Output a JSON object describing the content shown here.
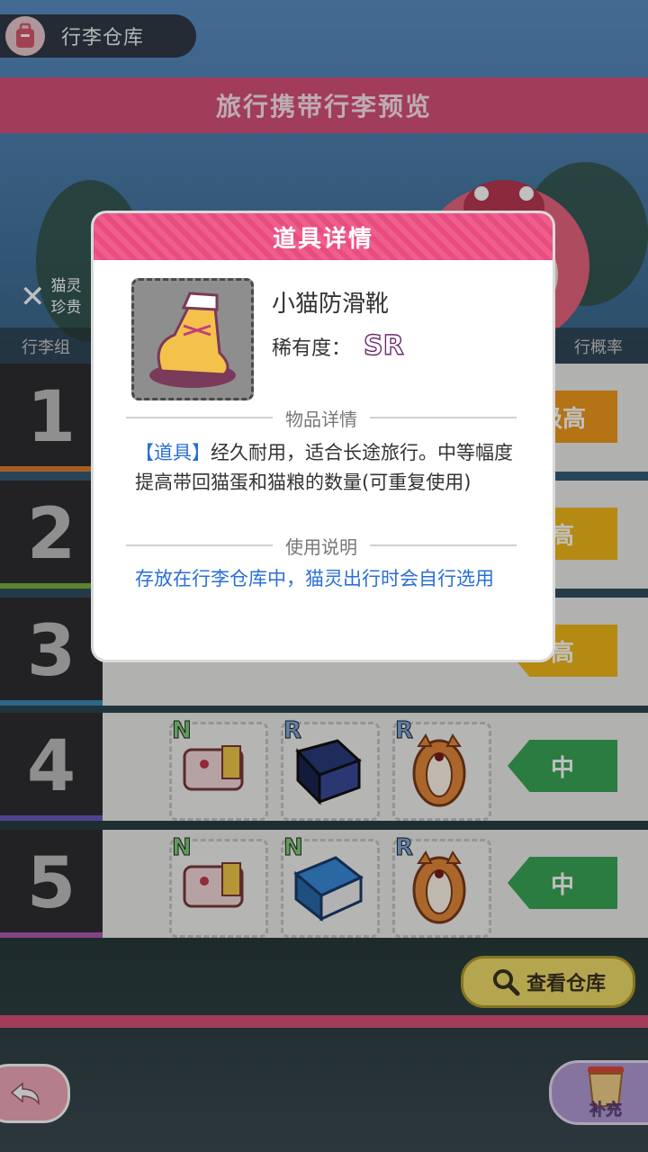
{
  "header": {
    "title": "行李仓库",
    "banner": "旅行携带行李预览"
  },
  "side_label": {
    "line1": "猫灵",
    "line2": "珍贵"
  },
  "columns": {
    "left": "行李组",
    "right": "行概率"
  },
  "rows": [
    {
      "num": "1",
      "tag": "级高",
      "bar_color": "#e07a2a",
      "tag_color": "#f19a1c",
      "items": []
    },
    {
      "num": "2",
      "tag": "高",
      "bar_color": "#7ab03a",
      "tag_color": "#f0b81a",
      "items": []
    },
    {
      "num": "3",
      "tag": "高",
      "bar_color": "#3a8ab5",
      "tag_color": "#f0b81a",
      "items": []
    },
    {
      "num": "4",
      "tag": "中",
      "bar_color": "#6a5ac0",
      "tag_color": "#3aa657",
      "items": [
        {
          "rarity": "N",
          "rcolor": "#7fd17a",
          "icon": "lunchbox-icon"
        },
        {
          "rarity": "R",
          "rcolor": "#7fa8e0",
          "icon": "dark-book-icon"
        },
        {
          "rarity": "R",
          "rcolor": "#7fa8e0",
          "icon": "cat-sleeping-bag-icon"
        }
      ]
    },
    {
      "num": "5",
      "tag": "中",
      "bar_color": "#b05ab0",
      "tag_color": "#3aa657",
      "items": [
        {
          "rarity": "N",
          "rcolor": "#7fd17a",
          "icon": "lunchbox-icon"
        },
        {
          "rarity": "N",
          "rcolor": "#7fd17a",
          "icon": "blue-book-icon"
        },
        {
          "rarity": "R",
          "rcolor": "#7fa8e0",
          "icon": "cat-sleeping-bag-icon"
        }
      ]
    }
  ],
  "buttons": {
    "view_storage": "查看仓库",
    "refill": "补充"
  },
  "modal": {
    "title": "道具详情",
    "item_name": "小猫防滑靴",
    "rarity_label": "稀有度：",
    "rarity_value": "SR",
    "section_details": "物品详情",
    "desc_keyword": "【道具】",
    "desc_text": "经久耐用，适合长途旅行。中等幅度提高带回猫蛋和猫粮的数量(可重复使用)",
    "section_usage": "使用说明",
    "usage_text": "存放在行李仓库中，猫灵出行时会自行选用",
    "item_icon": "cat-boots-icon"
  }
}
